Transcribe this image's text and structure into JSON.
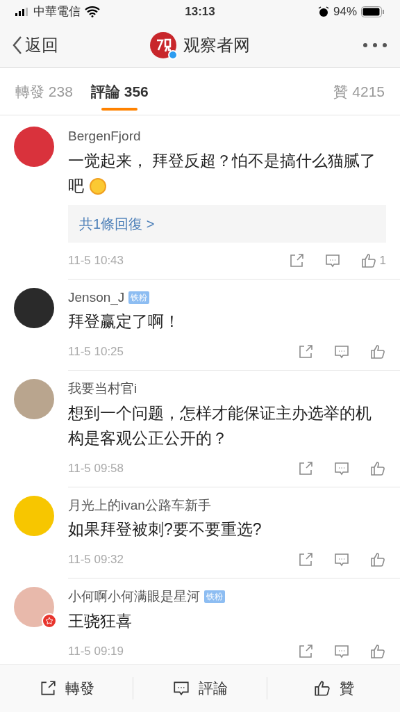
{
  "status_bar": {
    "carrier": "中華電信",
    "time": "13:13",
    "battery": "94%"
  },
  "nav": {
    "back": "返回",
    "title": "观察者网",
    "verified": true
  },
  "tabs": [
    {
      "label": "轉發 238",
      "selected": false
    },
    {
      "label": "評論 356",
      "selected": true
    },
    {
      "label": "贊 4215",
      "selected": false
    }
  ],
  "comments": [
    {
      "user": "BergenFjord",
      "text": "一觉起来， 拜登反超？怕不是搞什么猫腻了吧",
      "emoji": true,
      "replies": "共1條回復 >",
      "time": "11-5 10:43",
      "likes": "1",
      "verified": false
    },
    {
      "user": "Jenson_J",
      "badge": "铁粉",
      "text": "拜登赢定了啊！",
      "emoji": false,
      "time": "11-5 10:25",
      "verified": false
    },
    {
      "user": "我要当村官i",
      "text": "想到一个问题，怎样才能保证主办选举的机构是客观公正公开的？",
      "emoji": false,
      "time": "11-5 09:58",
      "verified": false
    },
    {
      "user": "月光上的ivan公路车新手",
      "text": "如果拜登被刺?要不要重选?",
      "emoji": false,
      "time": "11-5 09:32",
      "verified": false
    },
    {
      "user": "小何啊小何满眼是星河",
      "badge": "铁粉",
      "text": "王骁狂喜",
      "emoji": false,
      "time": "11-5 09:19",
      "verified": true
    }
  ],
  "bottom_bar": [
    {
      "kind": "repost",
      "label": "轉發"
    },
    {
      "kind": "comment",
      "label": "評論"
    },
    {
      "kind": "like",
      "label": "贊"
    }
  ]
}
